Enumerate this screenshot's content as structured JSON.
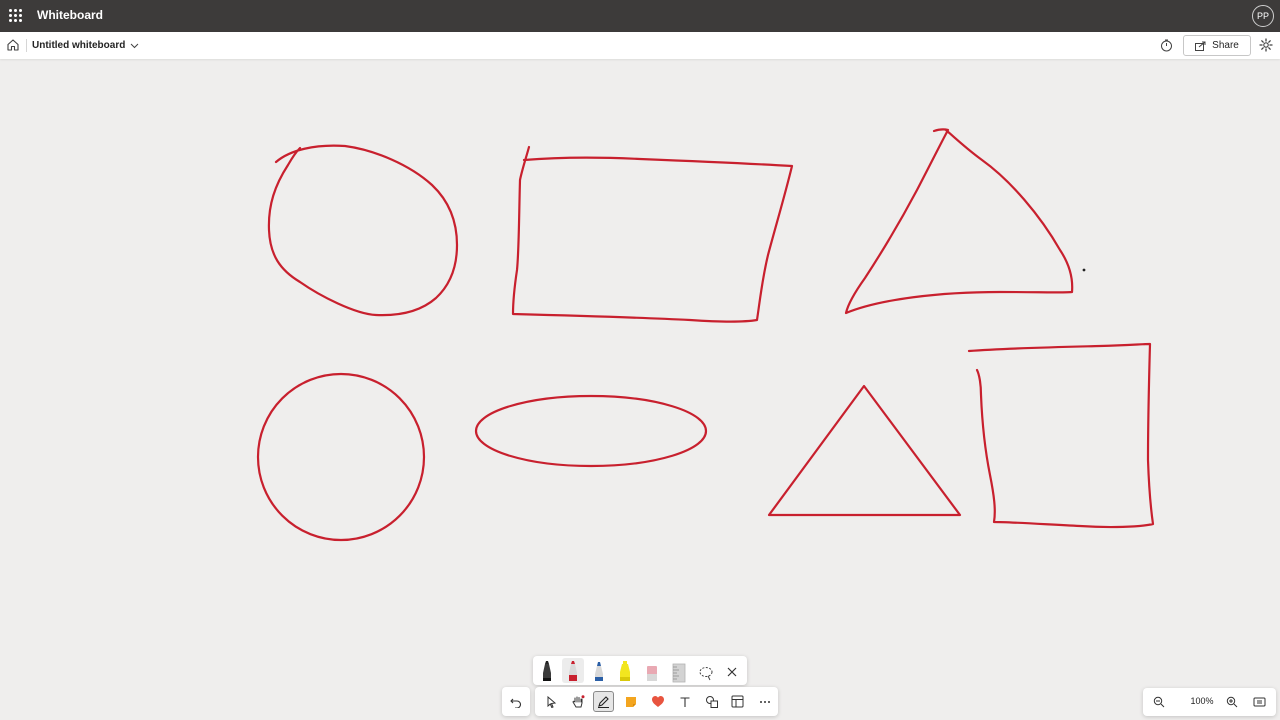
{
  "app": {
    "title": "Whiteboard",
    "user_initials": "PP"
  },
  "document": {
    "title": "Untitled whiteboard"
  },
  "header": {
    "share_label": "Share"
  },
  "canvas": {
    "ink_color": "#c8202e",
    "background_color": "#efeeed"
  },
  "pen_tray": {
    "tools": [
      "black-pen",
      "red-pen",
      "blue-pen",
      "yellow-highlighter",
      "eraser",
      "ruler",
      "lasso-select",
      "close"
    ],
    "selected": "red-pen"
  },
  "toolbar": {
    "tools": [
      "undo",
      "select",
      "pan",
      "inking",
      "sticky-note",
      "reactions",
      "text",
      "shapes",
      "templates",
      "more"
    ],
    "selected": "inking"
  },
  "zoom": {
    "level": "100%"
  }
}
